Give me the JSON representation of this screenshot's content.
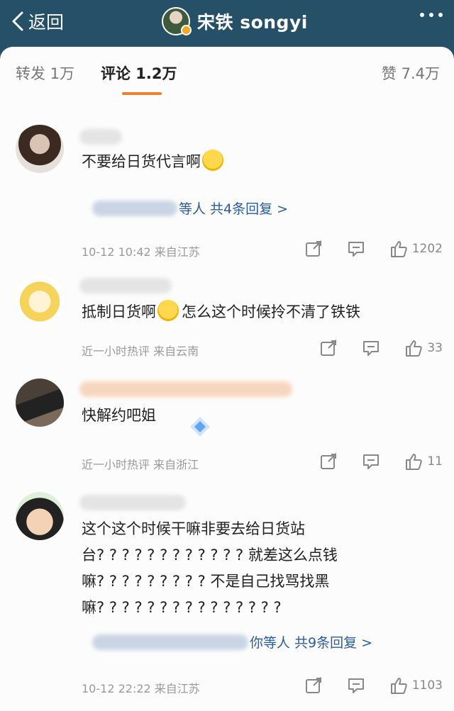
{
  "topbar": {
    "back_label": "返回",
    "profile_name": "宋铁 songyi"
  },
  "tabs": [
    {
      "label": "转发 1万"
    },
    {
      "label": "评论 1.2万"
    },
    {
      "label": "赞 7.4万"
    }
  ],
  "colors": {
    "header_bg": "#255067",
    "tab_accent": "#f0822a",
    "link_blue": "#2a5d9a",
    "meta_gray": "#9a9a9a"
  },
  "comments": [
    {
      "lines": [
        "不要给日货代言啊"
      ],
      "emoji": "crying-face",
      "reply_text": "等人 共4条回复 >",
      "meta": "10-12 10:42  来自江苏",
      "likes": "1202"
    },
    {
      "lines": [
        "抵制日货啊",
        "怎么这个时候拎不清了铁铁"
      ],
      "emoji": "laughing-tears-face",
      "meta": "近一小时热评  来自云南",
      "likes": "33"
    },
    {
      "lines": [
        "快解约吧姐"
      ],
      "emoji": "sparkle-diamond",
      "meta": "近一小时热评  来自浙江",
      "likes": "11"
    },
    {
      "lines": [
        "这个这个时候干嘛非要去给日货站",
        "台? ? ? ? ? ? ? ? ? ? ? ?  就差这么点钱",
        "嘛? ? ? ? ? ? ? ? ?  不是自己找骂找黑",
        "嘛? ? ? ? ? ? ? ? ? ? ? ? ? ? ?"
      ],
      "reply_text": "你等人 共9条回复 >",
      "meta": "10-12 22:22  来自江苏",
      "likes": "1103"
    }
  ]
}
